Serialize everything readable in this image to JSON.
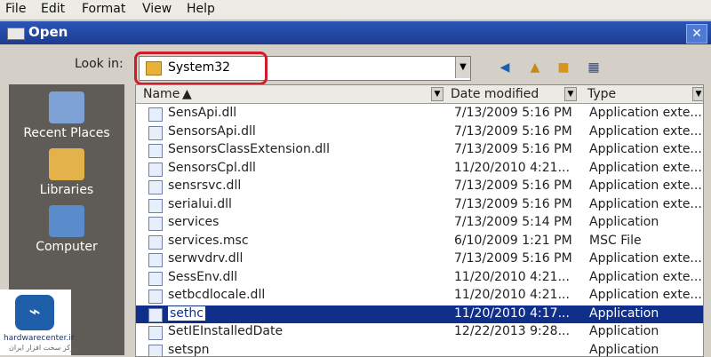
{
  "menu": {
    "file": "File",
    "edit": "Edit",
    "format": "Format",
    "view": "View",
    "help": "Help"
  },
  "dialog": {
    "title": "Open",
    "look_in_label": "Look in:",
    "look_in_value": "System32"
  },
  "places": [
    {
      "label": "Recent Places"
    },
    {
      "label": "Libraries"
    },
    {
      "label": "Computer"
    }
  ],
  "columns": {
    "name": "Name",
    "date": "Date modified",
    "type": "Type"
  },
  "files": [
    {
      "name": "SensApi.dll",
      "date": "7/13/2009 5:16 PM",
      "type": "Application exte..."
    },
    {
      "name": "SensorsApi.dll",
      "date": "7/13/2009 5:16 PM",
      "type": "Application exte..."
    },
    {
      "name": "SensorsClassExtension.dll",
      "date": "7/13/2009 5:16 PM",
      "type": "Application exte..."
    },
    {
      "name": "SensorsCpl.dll",
      "date": "11/20/2010 4:21...",
      "type": "Application exte..."
    },
    {
      "name": "sensrsvc.dll",
      "date": "7/13/2009 5:16 PM",
      "type": "Application exte..."
    },
    {
      "name": "serialui.dll",
      "date": "7/13/2009 5:16 PM",
      "type": "Application exte..."
    },
    {
      "name": "services",
      "date": "7/13/2009 5:14 PM",
      "type": "Application"
    },
    {
      "name": "services.msc",
      "date": "6/10/2009 1:21 PM",
      "type": "MSC File"
    },
    {
      "name": "serwvdrv.dll",
      "date": "7/13/2009 5:16 PM",
      "type": "Application exte..."
    },
    {
      "name": "SessEnv.dll",
      "date": "11/20/2010 4:21...",
      "type": "Application exte..."
    },
    {
      "name": "setbcdlocale.dll",
      "date": "11/20/2010 4:21...",
      "type": "Application exte..."
    },
    {
      "name": "sethc",
      "date": "11/20/2010 4:17...",
      "type": "Application",
      "selected": true
    },
    {
      "name": "SetIEInstalledDate",
      "date": "12/22/2013 9:28...",
      "type": "Application"
    },
    {
      "name": "setspn",
      "date": "",
      "type": "Application"
    }
  ],
  "watermark": {
    "site": "hardwarecenter.ir",
    "tagline": "مرکز سخت افزار ایران"
  },
  "colors": {
    "title_bar": "#1b3c91",
    "selection": "#0f2f8a",
    "highlight_ring": "#cc1f2a"
  }
}
